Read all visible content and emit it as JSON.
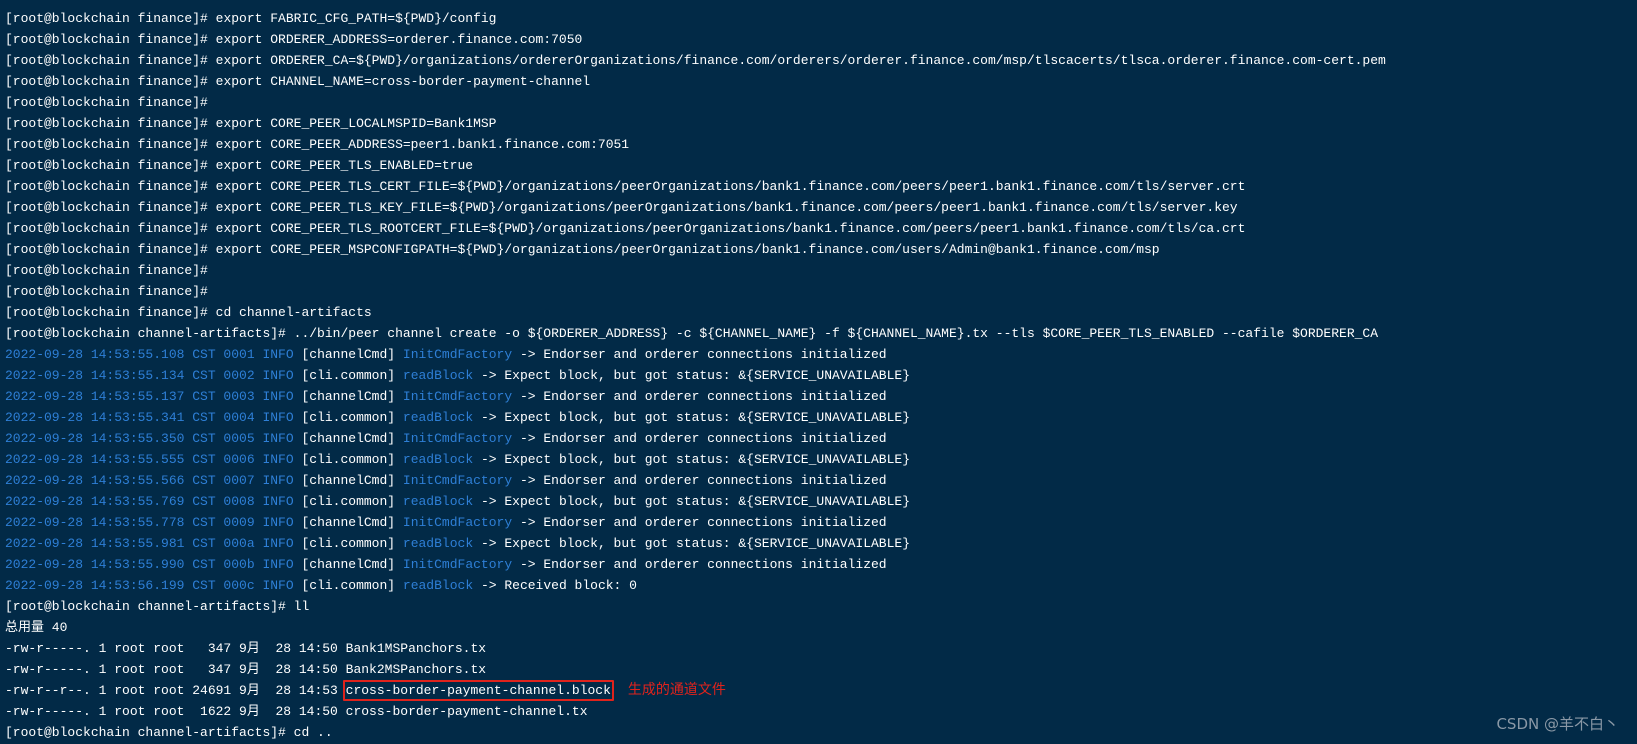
{
  "prompt": "[root@blockchain finance]# ",
  "prompt_artifacts": "[root@blockchain channel-artifacts]# ",
  "commands": [
    "export FABRIC_CFG_PATH=${PWD}/config",
    "export ORDERER_ADDRESS=orderer.finance.com:7050",
    "export ORDERER_CA=${PWD}/organizations/ordererOrganizations/finance.com/orderers/orderer.finance.com/msp/tlscacerts/tlsca.orderer.finance.com-cert.pem",
    "export CHANNEL_NAME=cross-border-payment-channel",
    "",
    "export CORE_PEER_LOCALMSPID=Bank1MSP",
    "export CORE_PEER_ADDRESS=peer1.bank1.finance.com:7051",
    "export CORE_PEER_TLS_ENABLED=true",
    "export CORE_PEER_TLS_CERT_FILE=${PWD}/organizations/peerOrganizations/bank1.finance.com/peers/peer1.bank1.finance.com/tls/server.crt",
    "export CORE_PEER_TLS_KEY_FILE=${PWD}/organizations/peerOrganizations/bank1.finance.com/peers/peer1.bank1.finance.com/tls/server.key",
    "export CORE_PEER_TLS_ROOTCERT_FILE=${PWD}/organizations/peerOrganizations/bank1.finance.com/peers/peer1.bank1.finance.com/tls/ca.crt",
    "export CORE_PEER_MSPCONFIGPATH=${PWD}/organizations/peerOrganizations/bank1.finance.com/users/Admin@bank1.finance.com/msp",
    "",
    "",
    "cd channel-artifacts"
  ],
  "create_command": "../bin/peer channel create -o ${ORDERER_ADDRESS} -c ${CHANNEL_NAME} -f ${CHANNEL_NAME}.tx --tls $CORE_PEER_TLS_ENABLED --cafile $ORDERER_CA",
  "logs": [
    {
      "ts": "2022-09-28 14:53:55.108 CST 0001 INFO",
      "mod": "[channelCmd]",
      "fn": "InitCmdFactory",
      "msg": "-> Endorser and orderer connections initialized"
    },
    {
      "ts": "2022-09-28 14:53:55.134 CST 0002 INFO",
      "mod": "[cli.common]",
      "fn": "readBlock",
      "msg": "-> Expect block, but got status: &{SERVICE_UNAVAILABLE}"
    },
    {
      "ts": "2022-09-28 14:53:55.137 CST 0003 INFO",
      "mod": "[channelCmd]",
      "fn": "InitCmdFactory",
      "msg": "-> Endorser and orderer connections initialized"
    },
    {
      "ts": "2022-09-28 14:53:55.341 CST 0004 INFO",
      "mod": "[cli.common]",
      "fn": "readBlock",
      "msg": "-> Expect block, but got status: &{SERVICE_UNAVAILABLE}"
    },
    {
      "ts": "2022-09-28 14:53:55.350 CST 0005 INFO",
      "mod": "[channelCmd]",
      "fn": "InitCmdFactory",
      "msg": "-> Endorser and orderer connections initialized"
    },
    {
      "ts": "2022-09-28 14:53:55.555 CST 0006 INFO",
      "mod": "[cli.common]",
      "fn": "readBlock",
      "msg": "-> Expect block, but got status: &{SERVICE_UNAVAILABLE}"
    },
    {
      "ts": "2022-09-28 14:53:55.566 CST 0007 INFO",
      "mod": "[channelCmd]",
      "fn": "InitCmdFactory",
      "msg": "-> Endorser and orderer connections initialized"
    },
    {
      "ts": "2022-09-28 14:53:55.769 CST 0008 INFO",
      "mod": "[cli.common]",
      "fn": "readBlock",
      "msg": "-> Expect block, but got status: &{SERVICE_UNAVAILABLE}"
    },
    {
      "ts": "2022-09-28 14:53:55.778 CST 0009 INFO",
      "mod": "[channelCmd]",
      "fn": "InitCmdFactory",
      "msg": "-> Endorser and orderer connections initialized"
    },
    {
      "ts": "2022-09-28 14:53:55.981 CST 000a INFO",
      "mod": "[cli.common]",
      "fn": "readBlock",
      "msg": "-> Expect block, but got status: &{SERVICE_UNAVAILABLE}"
    },
    {
      "ts": "2022-09-28 14:53:55.990 CST 000b INFO",
      "mod": "[channelCmd]",
      "fn": "InitCmdFactory",
      "msg": "-> Endorser and orderer connections initialized"
    },
    {
      "ts": "2022-09-28 14:53:56.199 CST 000c INFO",
      "mod": "[cli.common]",
      "fn": "readBlock",
      "msg": "-> Received block: 0"
    }
  ],
  "ll_command": "ll",
  "total": "总用量 40",
  "files": [
    {
      "meta": "-rw-r-----. 1 root root   347 9月  28 14:50 ",
      "name": "Bank1MSPanchors.tx"
    },
    {
      "meta": "-rw-r-----. 1 root root   347 9月  28 14:50 ",
      "name": "Bank2MSPanchors.tx"
    },
    {
      "meta": "-rw-r--r--. 1 root root 24691 9月  28 14:53 ",
      "name": "cross-border-payment-channel.block"
    },
    {
      "meta": "-rw-r-----. 1 root root  1622 9月  28 14:50 ",
      "name": "cross-border-payment-channel.tx"
    }
  ],
  "annotation": "生成的通道文件",
  "last_command": "cd ..",
  "watermark": "CSDN @羊不白丶",
  "colors": {
    "background": "#022a47",
    "log_blue": "#2e7fd6",
    "highlight_red": "#e0231c"
  }
}
